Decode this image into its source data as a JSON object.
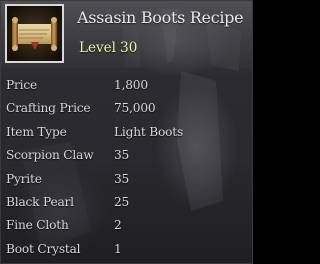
{
  "item": {
    "name": "Assasin Boots Recipe",
    "level": "Level 30",
    "icon": "recipe-scroll-icon"
  },
  "stats": [
    {
      "label": "Price",
      "value": "1,800"
    },
    {
      "label": "Crafting Price",
      "value": "75,000"
    },
    {
      "label": "Item Type",
      "value": "Light Boots"
    },
    {
      "label": "Scorpion Claw",
      "value": "35"
    },
    {
      "label": "Pyrite",
      "value": "35"
    },
    {
      "label": "Black Pearl",
      "value": "25"
    },
    {
      "label": "Fine Cloth",
      "value": "2"
    },
    {
      "label": "Boot Crystal",
      "value": "1"
    }
  ],
  "colors": {
    "name_text": "#e8e8ea",
    "level_text": "#f3f3a8",
    "stat_text": "#d8d8da",
    "icon_border": "#d8d8d8"
  }
}
